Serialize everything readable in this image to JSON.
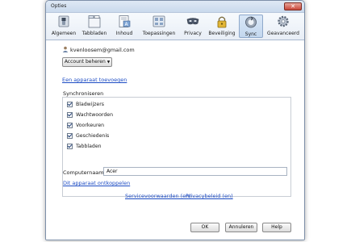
{
  "window": {
    "title": "Opties",
    "close_glyph": "✕"
  },
  "tabs": [
    {
      "label": "Algemeen",
      "icon": "switch-icon"
    },
    {
      "label": "Tabbladen",
      "icon": "tabs-icon"
    },
    {
      "label": "Inhoud",
      "icon": "content-icon"
    },
    {
      "label": "Toepassingen",
      "icon": "applications-icon"
    },
    {
      "label": "Privacy",
      "icon": "mask-icon"
    },
    {
      "label": "Beveiliging",
      "icon": "lock-icon"
    },
    {
      "label": "Sync",
      "icon": "sync-icon",
      "selected": true
    },
    {
      "label": "Geavanceerd",
      "icon": "gear-icon"
    }
  ],
  "sync": {
    "account_email": "kvenloosem@gmail.com",
    "manage_account_label": "Account beheren",
    "add_device_link": "Een apparaat toevoegen",
    "sync_heading": "Synchroniseren",
    "items": [
      {
        "label": "Bladwijzers",
        "checked": true
      },
      {
        "label": "Wachtwoorden",
        "checked": true
      },
      {
        "label": "Voorkeuren",
        "checked": true
      },
      {
        "label": "Geschiedenis",
        "checked": true
      },
      {
        "label": "Tabbladen",
        "checked": true
      }
    ],
    "computer_name_label": "Computernaam:",
    "computer_name_value": "Acer",
    "disconnect_link": "Dit apparaat ontkoppelen",
    "terms_link": "Servicevoorwaarden (en)",
    "privacy_link": "Privacybeleid (en)"
  },
  "buttons": {
    "ok": "OK",
    "cancel": "Annuleren",
    "help": "Help"
  },
  "colors": {
    "link": "#1d4cc4",
    "window_bg": "#eef3f9",
    "selected_tab": "#c3d7ee"
  }
}
